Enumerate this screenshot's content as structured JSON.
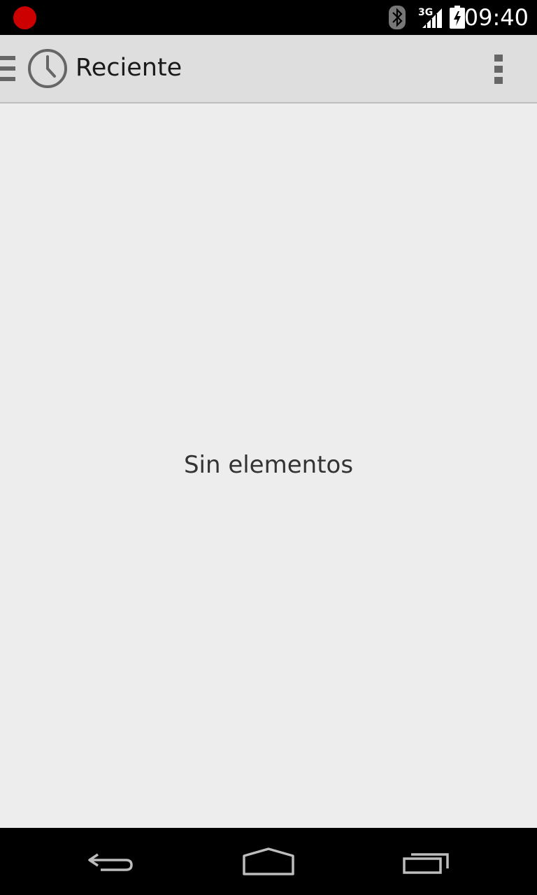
{
  "status_bar": {
    "network_label": "3G",
    "time": "09:40",
    "icons": [
      "record-indicator-icon",
      "bluetooth-icon",
      "signal-3g-icon",
      "battery-charging-icon"
    ]
  },
  "action_bar": {
    "title": "Reciente",
    "icons": [
      "drawer-indicator-icon",
      "clock-icon",
      "overflow-menu-icon"
    ]
  },
  "content": {
    "empty_message": "Sin elementos"
  },
  "nav_bar": {
    "icons": [
      "back-icon",
      "home-icon",
      "recents-icon"
    ]
  },
  "colors": {
    "record_dot": "#cc0000",
    "action_bar_bg": "#dedede",
    "content_bg": "#ededed"
  }
}
